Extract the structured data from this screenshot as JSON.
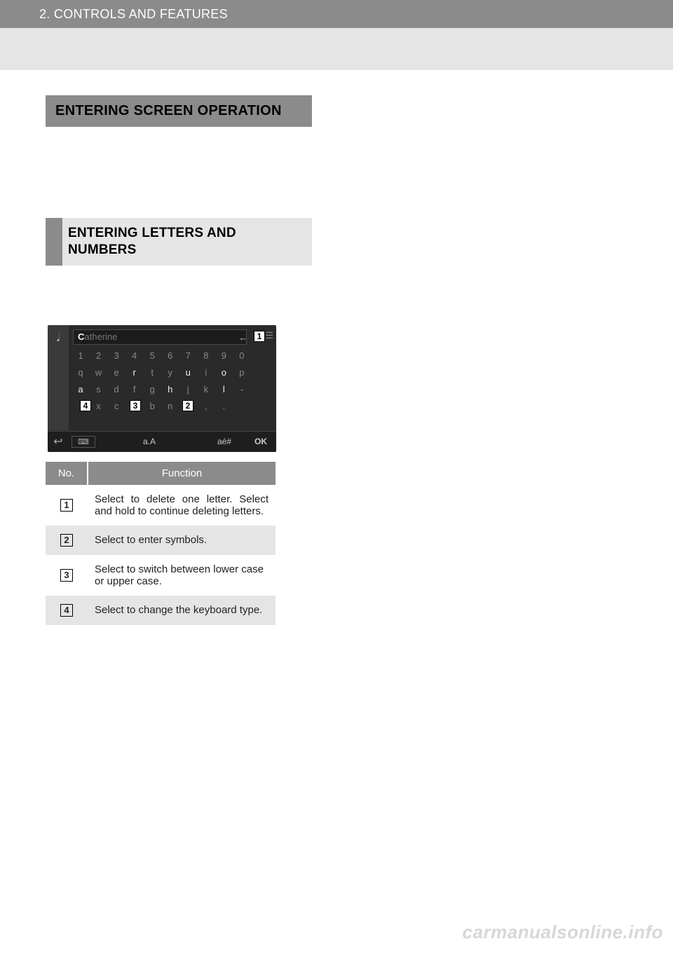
{
  "header": {
    "chapter": "2. CONTROLS AND FEATURES"
  },
  "section": {
    "title": "ENTERING SCREEN OPERATION"
  },
  "subsection": {
    "title": "ENTERING LETTERS AND NUMBERS"
  },
  "screenshot": {
    "input_faint": "atherine",
    "input_cursor": "C",
    "row1": [
      "1",
      "2",
      "3",
      "4",
      "5",
      "6",
      "7",
      "8",
      "9",
      "0"
    ],
    "row2": [
      "q",
      "w",
      "e",
      "r",
      "t",
      "y",
      "u",
      "i",
      "o",
      "p"
    ],
    "row3": [
      "a",
      "s",
      "d",
      "f",
      "g",
      "h",
      "j",
      "k",
      "l",
      "-"
    ],
    "row4": [
      "",
      "x",
      "c",
      "",
      "b",
      "n",
      "",
      ",",
      ".",
      ""
    ],
    "footer": {
      "aA": "a.A",
      "ae": "aé#",
      "ok": "OK"
    },
    "arrows": {
      "back": "←",
      "return": "↩"
    },
    "callouts": {
      "c1": "1",
      "c2": "2",
      "c3": "3",
      "c4": "4"
    }
  },
  "table": {
    "headers": {
      "no": "No.",
      "func": "Function"
    },
    "rows": [
      {
        "no": "1",
        "func": "Select to delete one letter. Select and hold to continue deleting letters."
      },
      {
        "no": "2",
        "func": "Select to enter symbols."
      },
      {
        "no": "3",
        "func": "Select to switch between lower case or upper case."
      },
      {
        "no": "4",
        "func": "Select to change the keyboard type."
      }
    ]
  },
  "watermark": "carmanualsonline.info"
}
